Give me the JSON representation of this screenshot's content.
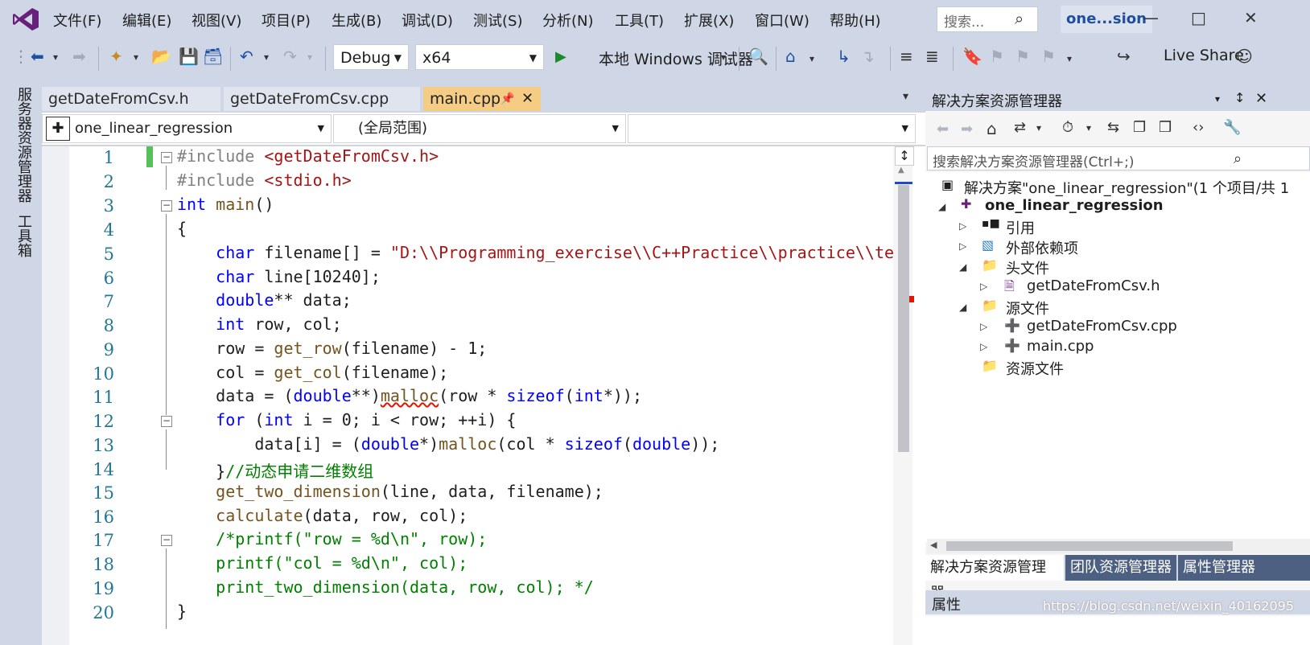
{
  "menu": {
    "items": [
      "文件(F)",
      "编辑(E)",
      "视图(V)",
      "项目(P)",
      "生成(B)",
      "调试(D)",
      "测试(S)",
      "分析(N)",
      "工具(T)",
      "扩展(X)",
      "窗口(W)",
      "帮助(H)"
    ],
    "search_placeholder": "搜索...",
    "project_title": "one...sion"
  },
  "toolbar": {
    "config": "Debug",
    "platform": "x64",
    "run_label": "本地 Windows 调试器",
    "live_share": "Live Share"
  },
  "left_strip": {
    "server_explorer": "服务器资源管理器",
    "toolbox": "工具箱"
  },
  "tabs": [
    {
      "label": "getDateFromCsv.h"
    },
    {
      "label": "getDateFromCsv.cpp"
    },
    {
      "label": "main.cpp"
    }
  ],
  "navbar": {
    "project": "one_linear_regression",
    "scope": "(全局范围)",
    "member": ""
  },
  "editor": {
    "line_numbers": [
      "1",
      "2",
      "3",
      "4",
      "5",
      "6",
      "7",
      "8",
      "9",
      "10",
      "11",
      "12",
      "13",
      "14",
      "15",
      "16",
      "17",
      "18",
      "19",
      "20"
    ]
  },
  "solution_explorer": {
    "title": "解决方案资源管理器",
    "search_placeholder": "搜索解决方案资源管理器(Ctrl+;)",
    "solution": "解决方案\"one_linear_regression\"(1 个项目/共 1",
    "project": "one_linear_regression",
    "nodes": [
      "引用",
      "外部依赖项",
      "头文件",
      "getDateFromCsv.h",
      "源文件",
      "getDateFromCsv.cpp",
      "main.cpp",
      "资源文件"
    ],
    "bottom_tabs": [
      "解决方案资源管理器",
      "团队资源管理器",
      "属性管理器"
    ]
  },
  "properties": {
    "title": "属性"
  },
  "watermark": "https://blog.csdn.net/weixin_40162095",
  "colors": {
    "chrome": "#cfd6e5",
    "active_tab": "#f5cc84",
    "keyword": "#0000ff",
    "string": "#a31515",
    "comment": "#008000"
  }
}
